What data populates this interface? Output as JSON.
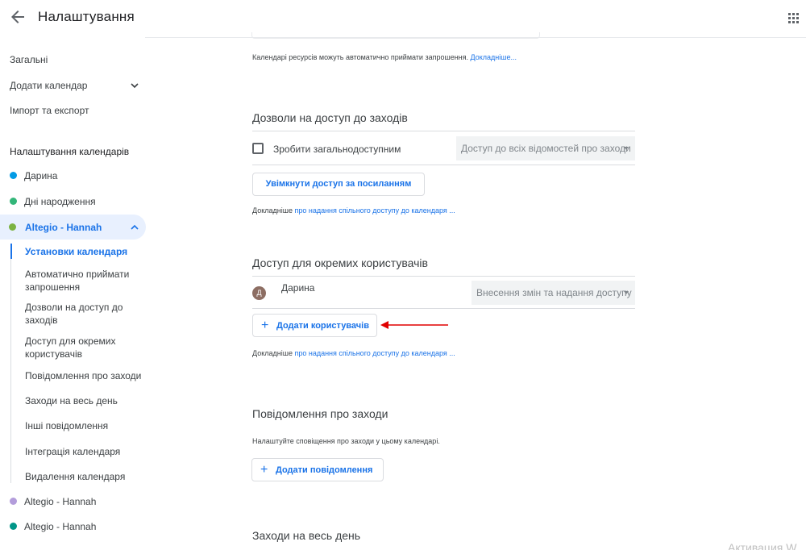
{
  "header": {
    "title": "Налаштування",
    "back_icon": "arrow-back-icon",
    "apps_icon": "apps-grid-icon"
  },
  "sidebar": {
    "general": "Загальні",
    "add_calendar": "Додати календар",
    "import_export": "Імпорт та експорт",
    "calendar_settings_label": "Налаштування календарів",
    "calendars": [
      {
        "label": "Дарина",
        "color": "#039be5"
      },
      {
        "label": "Дні народження",
        "color": "#33b679"
      },
      {
        "label": "Altegio - Hannah",
        "color": "#7cb342"
      },
      {
        "label": "Altegio - Hannah",
        "color": "#b39ddb"
      },
      {
        "label": "Altegio - Hannah",
        "color": "#009688"
      }
    ],
    "sub_items": [
      "Установки календаря",
      "Автоматично приймати запрошення",
      "Дозволи на доступ до заходів",
      "Доступ для окремих користувачів",
      "Повідомлення про заходи",
      "Заходи на весь день",
      "Інші повідомлення",
      "Інтеграція календаря",
      "Видалення календаря"
    ]
  },
  "main": {
    "resource_note": "Календарі ресурсів можуть автоматично приймати запрошення.",
    "resource_link": "Докладніше...",
    "permissions": {
      "title": "Дозволи на доступ до заходів",
      "public_checkbox_label": "Зробити загальнодоступним",
      "public_checked": false,
      "access_select": "Доступ до всіх відомостей про заходи",
      "link_button": "Увімкнути доступ за посиланням",
      "more_prefix": "Докладніше",
      "more_link": "про надання спільного доступу до календаря ..."
    },
    "users": {
      "title": "Доступ для окремих користувачів",
      "user_name": "Дарина",
      "user_initial": "Д",
      "user_permission": "Внесення змін та надання доступу",
      "add_button": "Додати користувачів",
      "more_prefix": "Докладніше",
      "more_link": "про надання спільного доступу до календаря ..."
    },
    "notifications": {
      "title": "Повідомлення про заходи",
      "description": "Налаштуйте сповіщення про заходи у цьому календарі.",
      "add_button": "Додати повідомлення"
    },
    "all_day": {
      "title": "Заходи на весь день"
    },
    "watermark": "Активация W"
  },
  "colors": {
    "accent": "#1a73e8",
    "annotation_arrow": "#e00000"
  }
}
